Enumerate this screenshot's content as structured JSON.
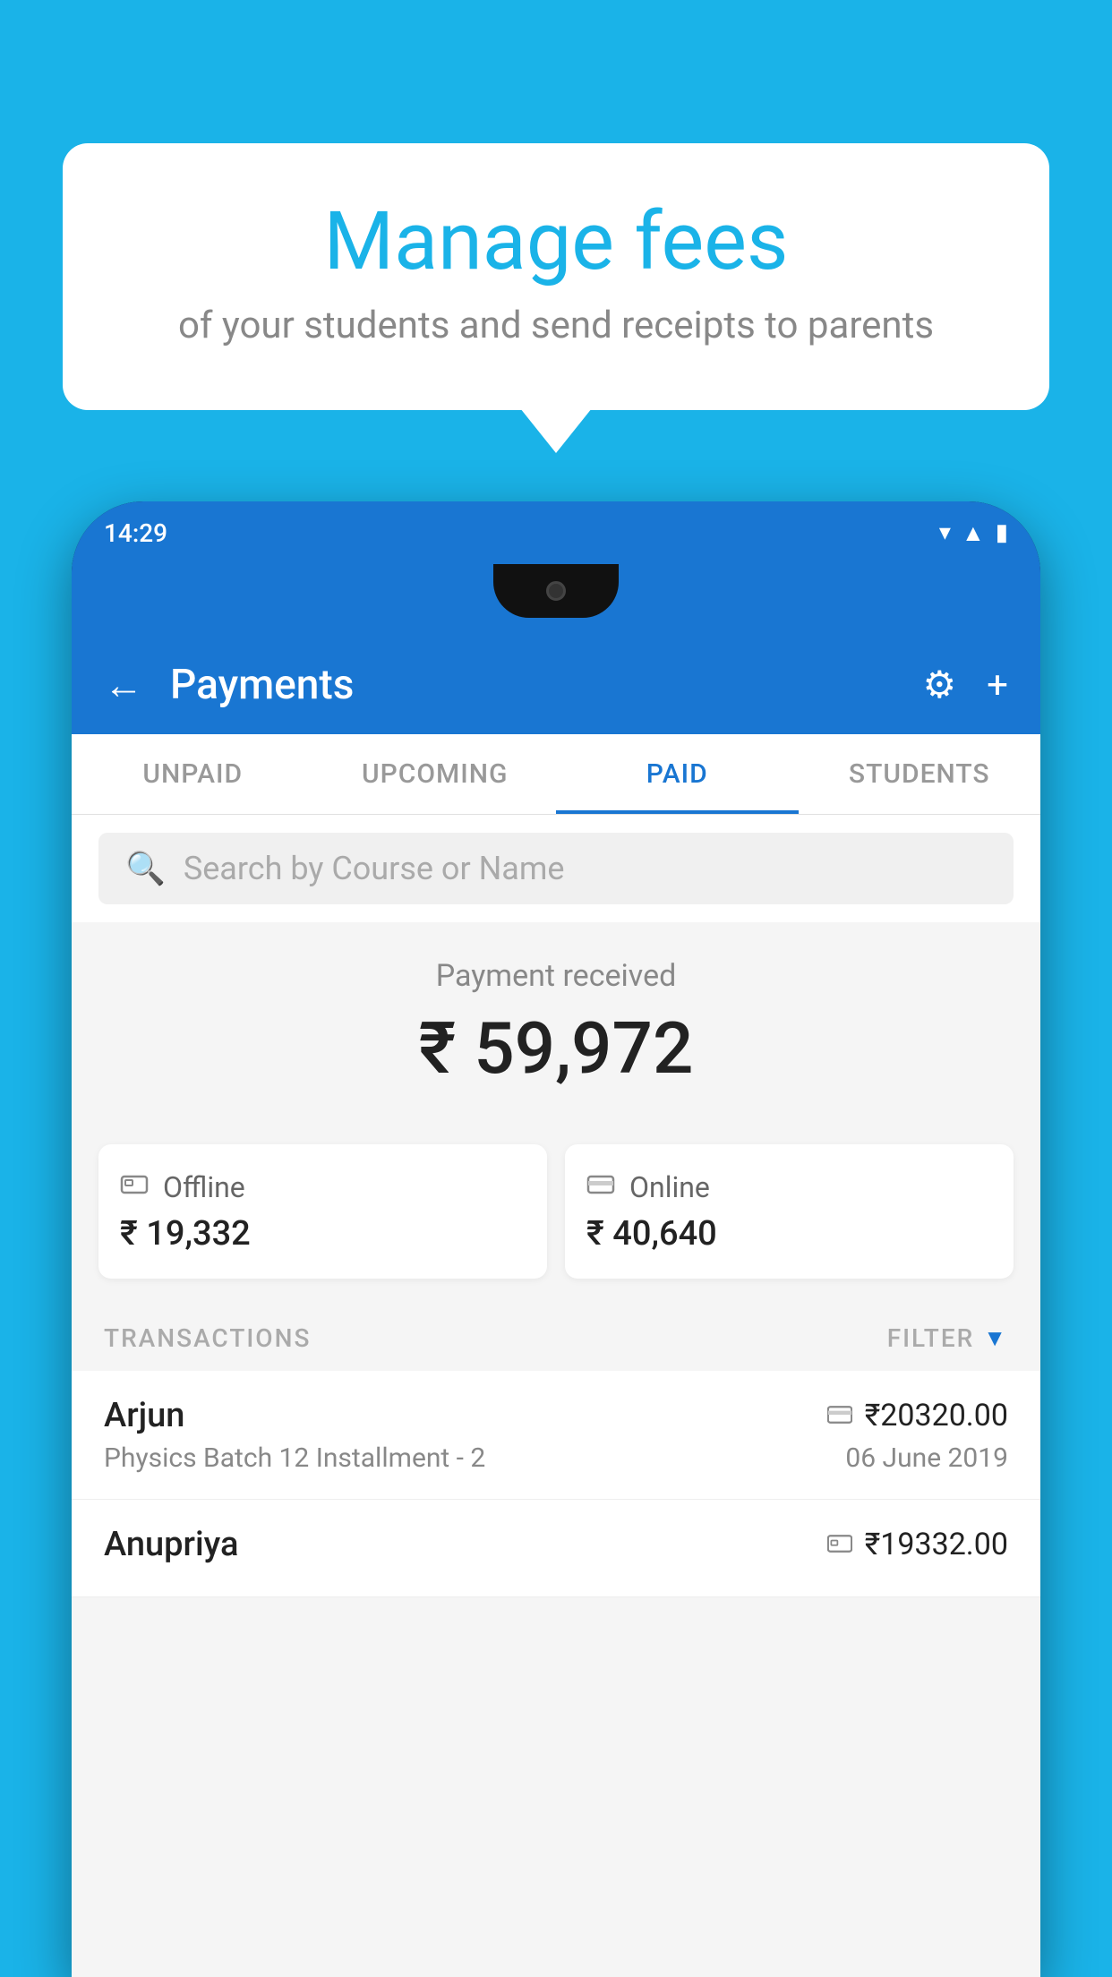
{
  "background_color": "#1ab3e8",
  "speech_bubble": {
    "title": "Manage fees",
    "subtitle": "of your students and send receipts to parents"
  },
  "status_bar": {
    "time": "14:29",
    "wifi_icon": "▼",
    "signal_icon": "▲",
    "battery_icon": "▮"
  },
  "header": {
    "back_icon": "←",
    "title": "Payments",
    "gear_icon": "⚙",
    "plus_icon": "+"
  },
  "tabs": [
    {
      "label": "UNPAID",
      "active": false
    },
    {
      "label": "UPCOMING",
      "active": false
    },
    {
      "label": "PAID",
      "active": true
    },
    {
      "label": "STUDENTS",
      "active": false
    }
  ],
  "search": {
    "placeholder": "Search by Course or Name"
  },
  "payment_summary": {
    "received_label": "Payment received",
    "amount": "₹ 59,972",
    "offline": {
      "label": "Offline",
      "amount": "₹ 19,332"
    },
    "online": {
      "label": "Online",
      "amount": "₹ 40,640"
    }
  },
  "transactions": {
    "header_label": "TRANSACTIONS",
    "filter_label": "FILTER",
    "items": [
      {
        "name": "Arjun",
        "amount": "₹20320.00",
        "detail": "Physics Batch 12 Installment - 2",
        "date": "06 June 2019",
        "mode": "online"
      },
      {
        "name": "Anupriya",
        "amount": "₹19332.00",
        "detail": "",
        "date": "",
        "mode": "offline"
      }
    ]
  }
}
